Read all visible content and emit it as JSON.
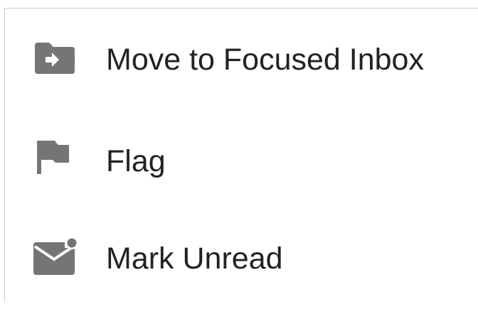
{
  "menu": {
    "items": [
      {
        "label": "Move to Focused Inbox",
        "icon": "folder-arrow-icon"
      },
      {
        "label": "Flag",
        "icon": "flag-icon"
      },
      {
        "label": "Mark Unread",
        "icon": "envelope-unread-icon"
      }
    ]
  },
  "colors": {
    "icon": "#757575",
    "text": "#222222",
    "border": "#cfcfcf",
    "background": "#ffffff"
  }
}
